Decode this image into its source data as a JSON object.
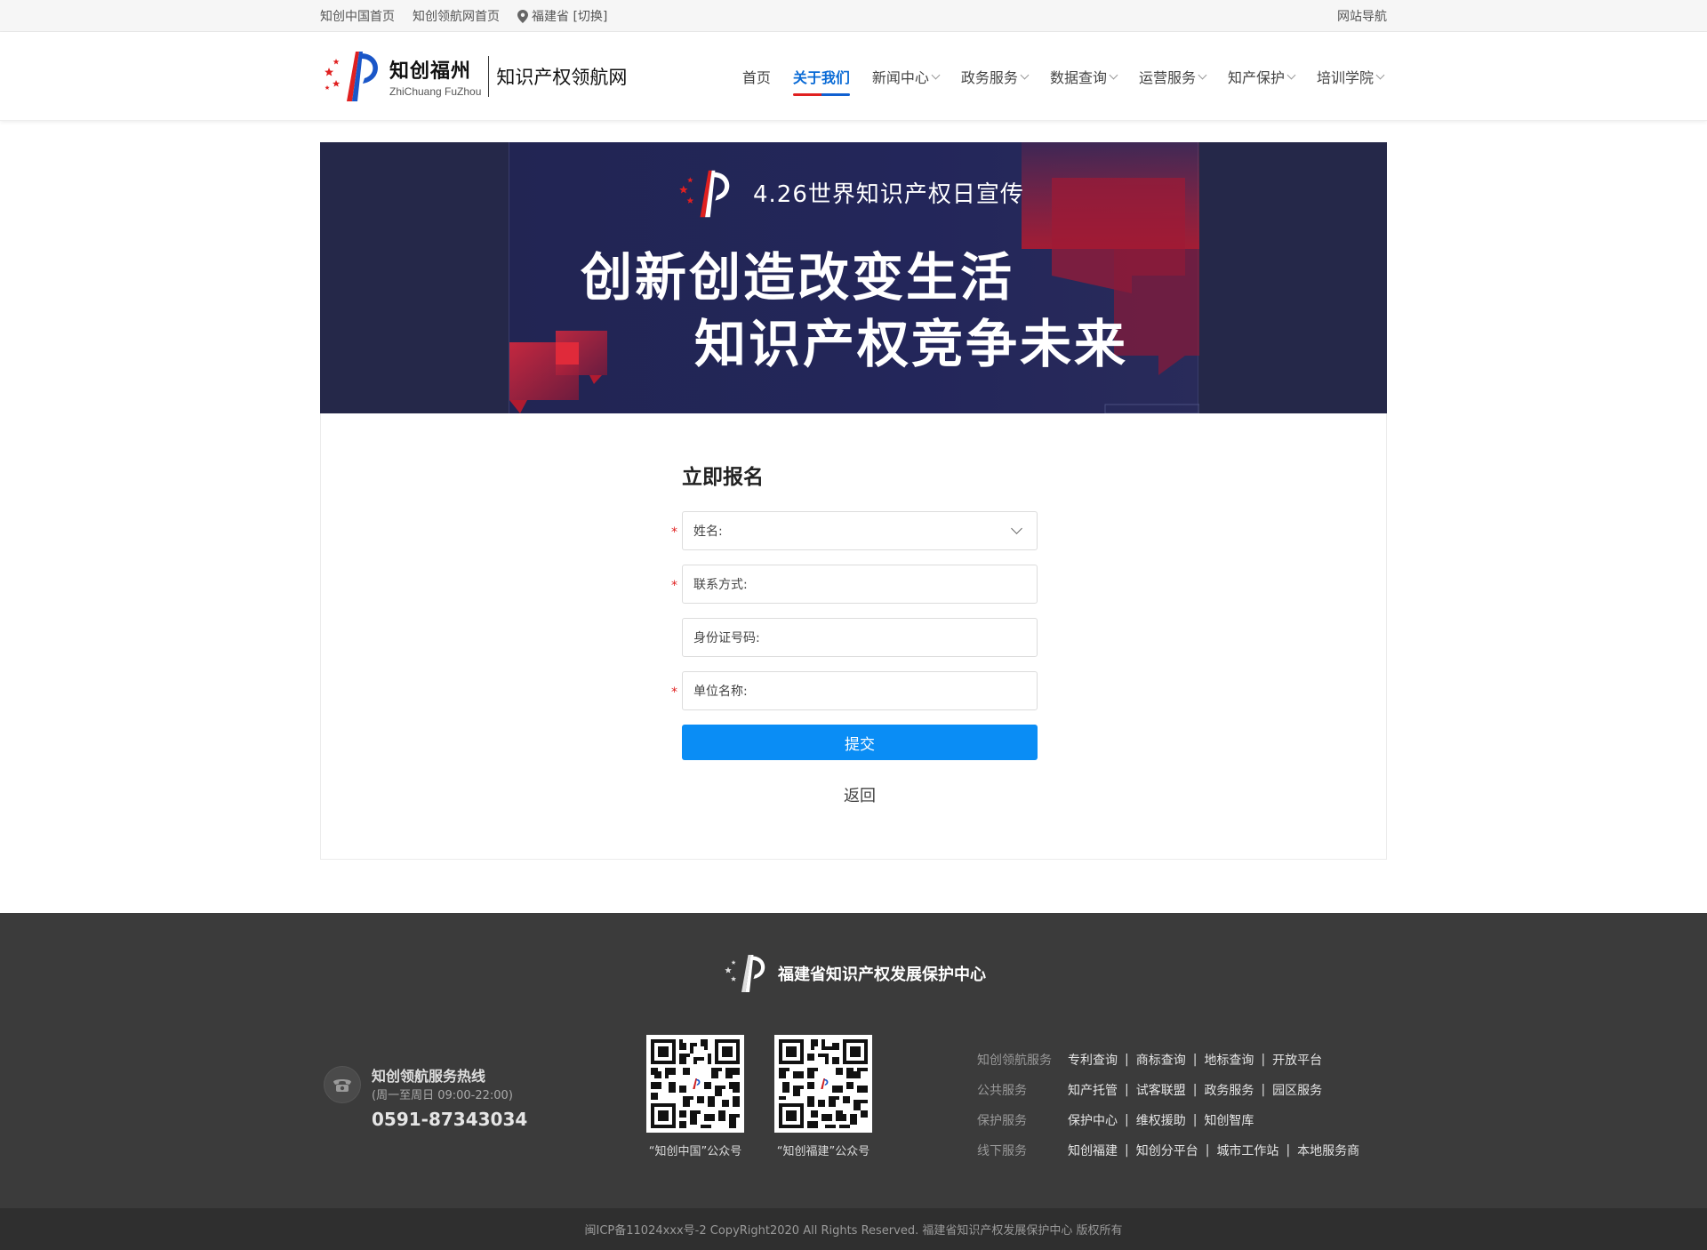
{
  "topbar": {
    "link1": "知创中国首页",
    "link2": "知创领航网首页",
    "location": "福建省 [切换]",
    "site_nav": "网站导航"
  },
  "header": {
    "logo_cn": "知创福州",
    "logo_en": "ZhiChuang FuZhou",
    "site_name": "知识产权领航网",
    "nav": [
      {
        "label": "首页",
        "active": false,
        "dropdown": false
      },
      {
        "label": "关于我们",
        "active": true,
        "dropdown": false
      },
      {
        "label": "新闻中心",
        "active": false,
        "dropdown": true
      },
      {
        "label": "政务服务",
        "active": false,
        "dropdown": true
      },
      {
        "label": "数据查询",
        "active": false,
        "dropdown": true
      },
      {
        "label": "运营服务",
        "active": false,
        "dropdown": true
      },
      {
        "label": "知产保护",
        "active": false,
        "dropdown": true
      },
      {
        "label": "培训学院",
        "active": false,
        "dropdown": true
      }
    ],
    "accent": "#0a6bd6"
  },
  "banner": {
    "subtitle": "4.26世界知识产权日宣传",
    "line1": "创新创造改变生活",
    "line2": "知识产权竞争未来"
  },
  "form": {
    "title": "立即报名",
    "fields": [
      {
        "label": "姓名:",
        "required": true,
        "select": true
      },
      {
        "label": "联系方式:",
        "required": true,
        "select": false
      },
      {
        "label": "身份证号码:",
        "required": false,
        "select": false
      },
      {
        "label": "单位名称:",
        "required": true,
        "select": false
      }
    ],
    "required_mark": "*",
    "submit": "提交",
    "back": "返回",
    "submit_color": "#0a8df5"
  },
  "footer": {
    "brand": "福建省知识产权发展保护中心",
    "hotline_title": "知创领航服务热线",
    "hotline_time": "(周一至周日 09:00-22:00)",
    "hotline_number": "0591-87343034",
    "qr1_caption": "“知创中国”公众号",
    "qr2_caption": "“知创福建”公众号",
    "link_rows": [
      {
        "category": "知创领航服务",
        "links": [
          "专利查询",
          "商标查询",
          "地标查询",
          "开放平台"
        ]
      },
      {
        "category": "公共服务",
        "links": [
          "知产托管",
          "试客联盟",
          "政务服务",
          "园区服务"
        ]
      },
      {
        "category": "保护服务",
        "links": [
          "保护中心",
          "维权援助",
          "知创智库"
        ]
      },
      {
        "category": "线下服务",
        "links": [
          "知创福建",
          "知创分平台",
          "城市工作站",
          "本地服务商"
        ]
      }
    ],
    "separator": "|",
    "copyright": "闽ICP备11024xxx号-2  CopyRight2020  All Rights Reserved.  福建省知识产权发展保护中心  版权所有"
  }
}
